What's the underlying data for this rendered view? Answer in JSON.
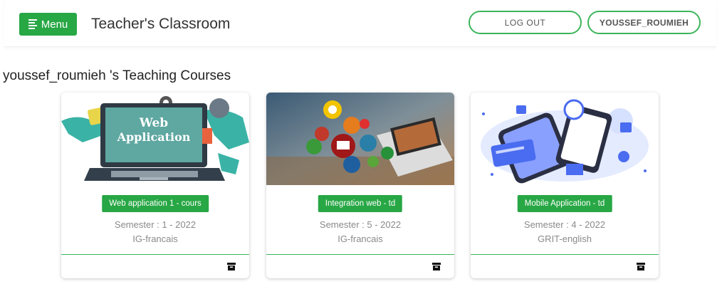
{
  "header": {
    "menu_label": "Menu",
    "app_title": "Teacher's Classroom",
    "logout_label": "LOG OUT",
    "username": "YOUSSEF_ROUMIEH",
    "accent_color": "#28a745"
  },
  "page": {
    "heading": "youssef_roumieh 's Teaching Courses"
  },
  "courses": [
    {
      "image_icon": "web-application-illustration",
      "image_text_line1": "Web",
      "image_text_line2": "Application",
      "title": "Web application 1 - cours",
      "semester": "Semester : 1 - 2022",
      "group": "IG-francais",
      "action_icon": "archive-icon"
    },
    {
      "image_icon": "integration-web-illustration",
      "title": "Integration web - td",
      "semester": "Semester : 5 - 2022",
      "group": "IG-francais",
      "action_icon": "archive-icon"
    },
    {
      "image_icon": "mobile-application-illustration",
      "title": "Mobile Application - td",
      "semester": "Semester : 4 - 2022",
      "group": "GRIT-english",
      "action_icon": "archive-icon"
    }
  ]
}
